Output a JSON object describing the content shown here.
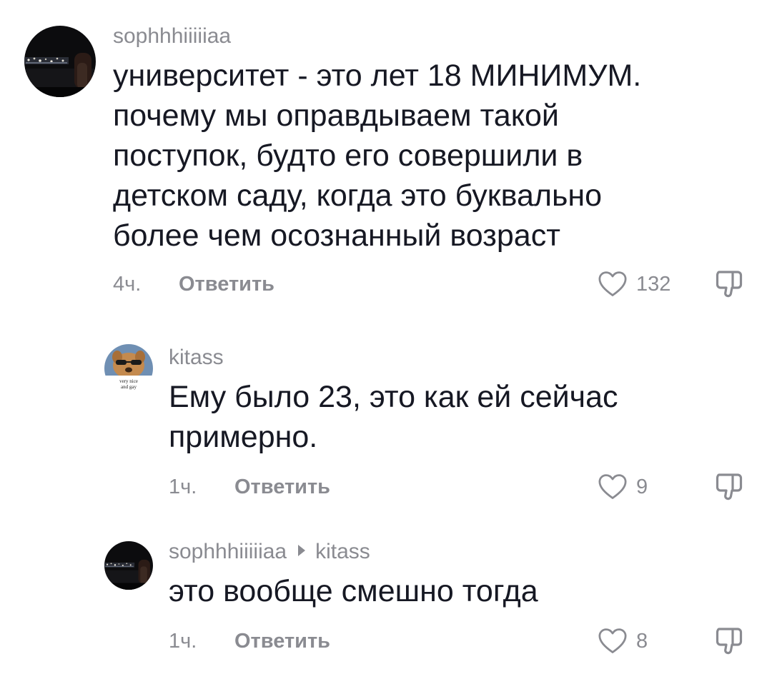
{
  "comments": [
    {
      "username": "sophhhiiiiiaa",
      "text_lines": [
        "университет - это лет 18 МИНИМУМ.",
        "почему мы оправдываем такой",
        "поступок, будто его совершили в",
        "детском саду, когда это буквально",
        "более чем осознанный возраст"
      ],
      "time": "4ч.",
      "reply_label": "Ответить",
      "likes": "132",
      "avatar_icon": "dark-night-photo-avatar"
    },
    {
      "username": "kitass",
      "text_lines": [
        "Ему было 23, это как ей сейчас",
        "примерно."
      ],
      "time": "1ч.",
      "reply_label": "Ответить",
      "likes": "9",
      "avatar_icon": "dog-meme-avatar",
      "avatar_caption": [
        "very nice",
        "and gay"
      ]
    },
    {
      "username": "sophhhiiiiiaa",
      "reply_to": "kitass",
      "text_lines": [
        "это вообще смешно тогда"
      ],
      "time": "1ч.",
      "reply_label": "Ответить",
      "likes": "8",
      "avatar_icon": "dark-night-photo-avatar"
    }
  ],
  "icons": {
    "like": "heart-outline-icon",
    "dislike": "thumbs-down-outline-icon"
  },
  "colors": {
    "text": "#161823",
    "secondary": "#8a8b91",
    "background": "#ffffff"
  }
}
